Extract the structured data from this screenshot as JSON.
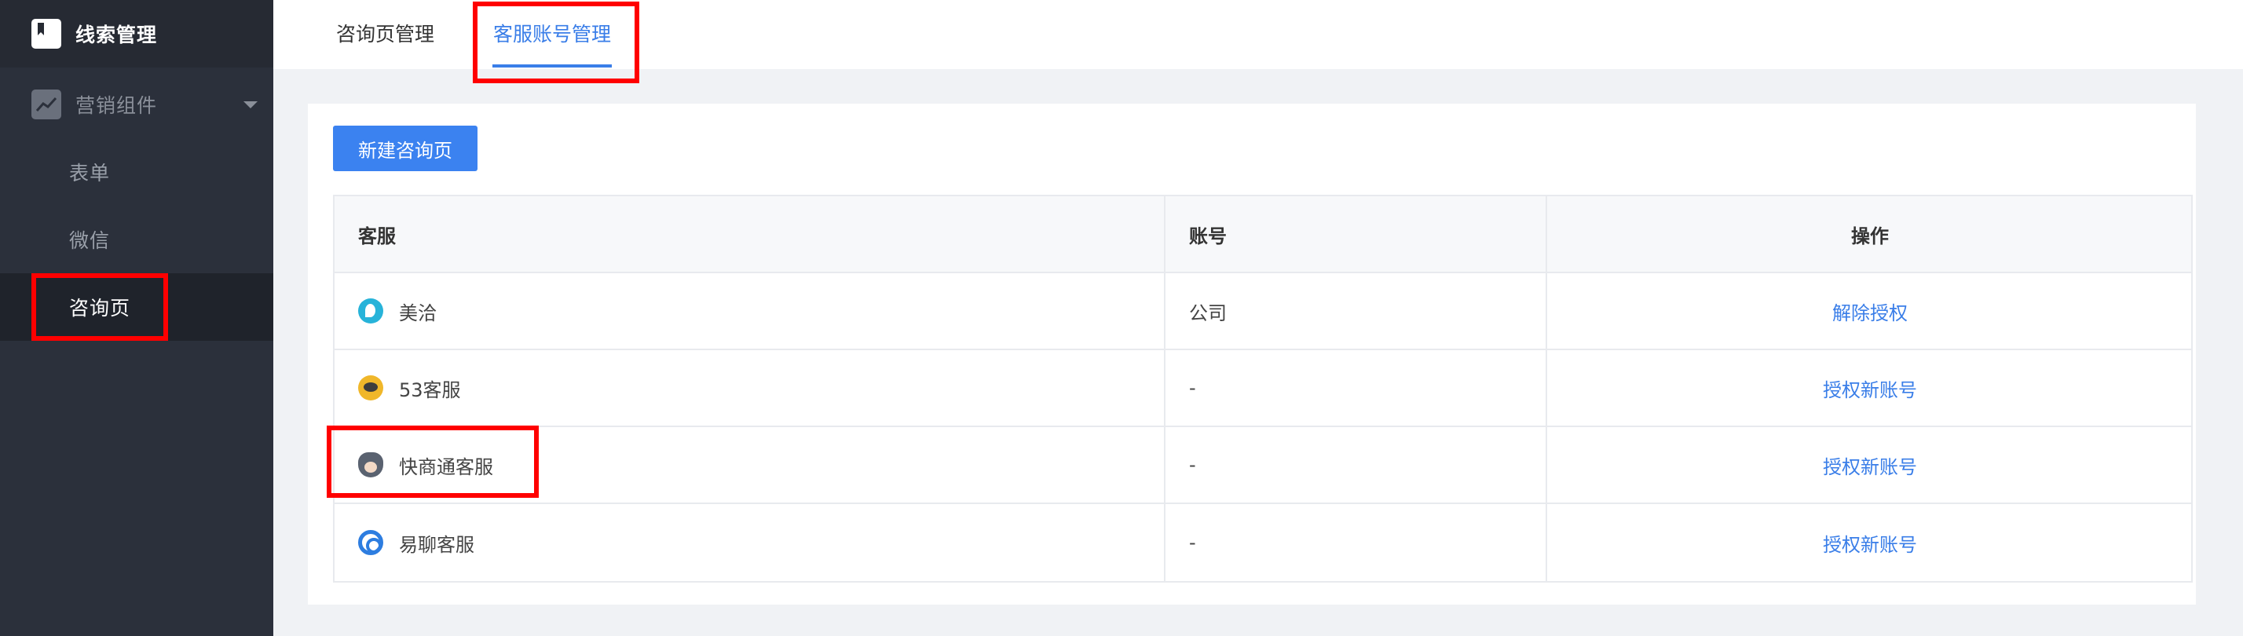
{
  "sidebar": {
    "title": "线索管理",
    "group_label": "营销组件",
    "items": [
      {
        "label": "表单"
      },
      {
        "label": "微信"
      },
      {
        "label": "咨询页"
      }
    ]
  },
  "tabs": [
    {
      "label": "咨询页管理"
    },
    {
      "label": "客服账号管理"
    }
  ],
  "toolbar": {
    "new_button": "新建咨询页"
  },
  "table": {
    "headers": [
      "客服",
      "账号",
      "操作"
    ],
    "rows": [
      {
        "service": "美洽",
        "account": "公司",
        "action": "解除授权",
        "icon": "meiqia-icon"
      },
      {
        "service": "53客服",
        "account": "-",
        "action": "授权新账号",
        "icon": "53kf-icon"
      },
      {
        "service": "快商通客服",
        "account": "-",
        "action": "授权新账号",
        "icon": "kuaishangtong-icon"
      },
      {
        "service": "易聊客服",
        "account": "-",
        "action": "授权新账号",
        "icon": "yiliao-icon"
      }
    ]
  },
  "colors": {
    "accent": "#3a7ee8",
    "sidebar_bg": "#2b303b",
    "highlight": "#ff0000"
  }
}
